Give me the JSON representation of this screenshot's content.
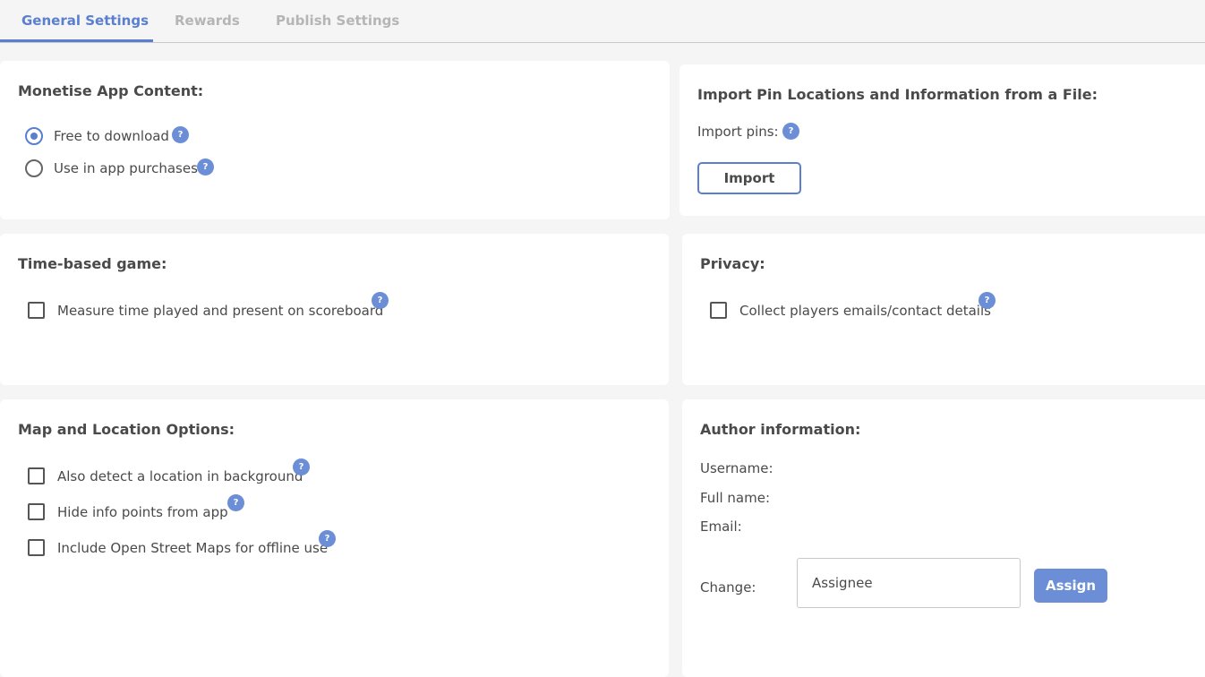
{
  "tabs": [
    {
      "label": "General Settings",
      "active": true
    },
    {
      "label": "Rewards",
      "active": false
    },
    {
      "label": "Publish Settings",
      "active": false
    }
  ],
  "help_glyph": "?",
  "monetise": {
    "title": "Monetise App Content:",
    "options": [
      {
        "label": "Free to download",
        "selected": true
      },
      {
        "label": "Use in app purchases",
        "selected": false
      }
    ]
  },
  "import": {
    "title": "Import Pin Locations and Information from a File:",
    "label": "Import pins:",
    "button": "Import"
  },
  "time_based": {
    "title": "Time-based game:",
    "options": [
      {
        "label": "Measure time played and present on scoreboard",
        "checked": false
      }
    ]
  },
  "privacy": {
    "title": "Privacy:",
    "options": [
      {
        "label": "Collect players emails/contact details",
        "checked": false
      }
    ]
  },
  "map": {
    "title": "Map and Location Options:",
    "options": [
      {
        "label": "Also detect a location in background",
        "checked": false
      },
      {
        "label": "Hide info points from app",
        "checked": false
      },
      {
        "label": "Include Open Street Maps for offline use",
        "checked": false
      }
    ]
  },
  "author": {
    "title": "Author information:",
    "username_label": "Username:",
    "fullname_label": "Full name:",
    "email_label": "Email:",
    "change_label": "Change:",
    "assignee_placeholder": "Assignee",
    "assign_button": "Assign"
  },
  "colors": {
    "accent": "#5a7fcf",
    "help_badge": "#6b8ed6",
    "inactive_tab": "#b5b5b5",
    "background": "#f5f5f5"
  }
}
